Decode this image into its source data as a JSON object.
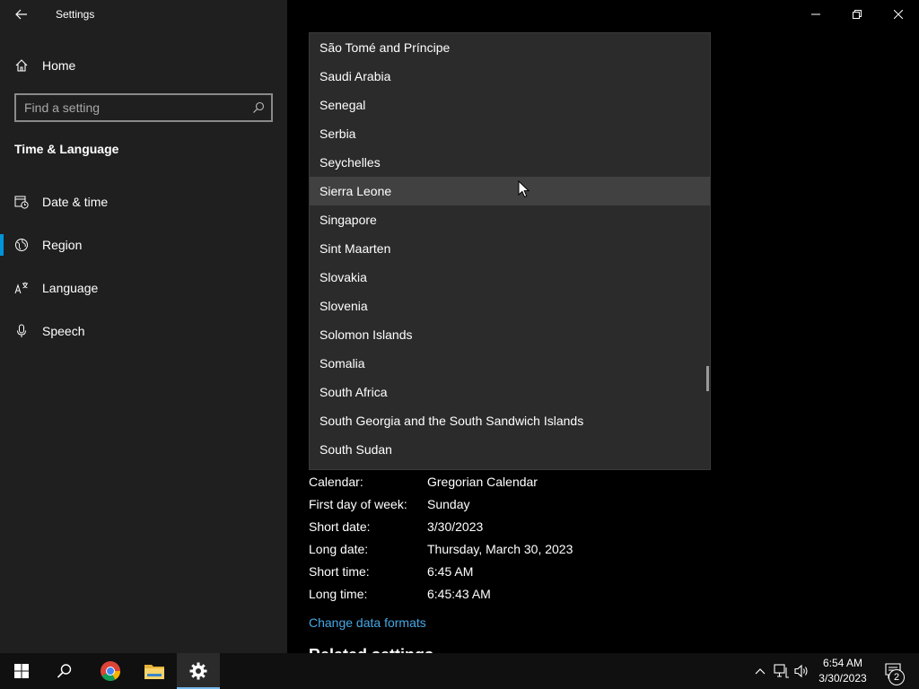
{
  "window": {
    "title": "Settings"
  },
  "sidebar": {
    "home_label": "Home",
    "search_placeholder": "Find a setting",
    "section_title": "Time & Language",
    "items": [
      {
        "label": "Date & time",
        "icon": "clock-calendar-icon"
      },
      {
        "label": "Region",
        "icon": "globe-icon",
        "selected": true
      },
      {
        "label": "Language",
        "icon": "language-icon"
      },
      {
        "label": "Speech",
        "icon": "microphone-icon"
      }
    ]
  },
  "dropdown": {
    "hover_index": 5,
    "items": [
      "São Tomé and Príncipe",
      "Saudi Arabia",
      "Senegal",
      "Serbia",
      "Seychelles",
      "Sierra Leone",
      "Singapore",
      "Sint Maarten",
      "Slovakia",
      "Slovenia",
      "Solomon Islands",
      "Somalia",
      "South Africa",
      "South Georgia and the South Sandwich Islands",
      "South Sudan"
    ]
  },
  "formats": {
    "rows": [
      {
        "key": "Calendar:",
        "value": "Gregorian Calendar"
      },
      {
        "key": "First day of week:",
        "value": "Sunday"
      },
      {
        "key": "Short date:",
        "value": "3/30/2023"
      },
      {
        "key": "Long date:",
        "value": "Thursday, March 30, 2023"
      },
      {
        "key": "Short time:",
        "value": "6:45 AM"
      },
      {
        "key": "Long time:",
        "value": "6:45:43 AM"
      }
    ],
    "change_link": "Change data formats",
    "related_heading": "Related settings"
  },
  "taskbar": {
    "time": "6:54 AM",
    "date": "3/30/2023",
    "notification_count": "2"
  },
  "colors": {
    "accent": "#0094d8",
    "link": "#45a8e6",
    "sidebar_bg": "#1f1f1f",
    "dropdown_bg": "#2b2b2b"
  }
}
